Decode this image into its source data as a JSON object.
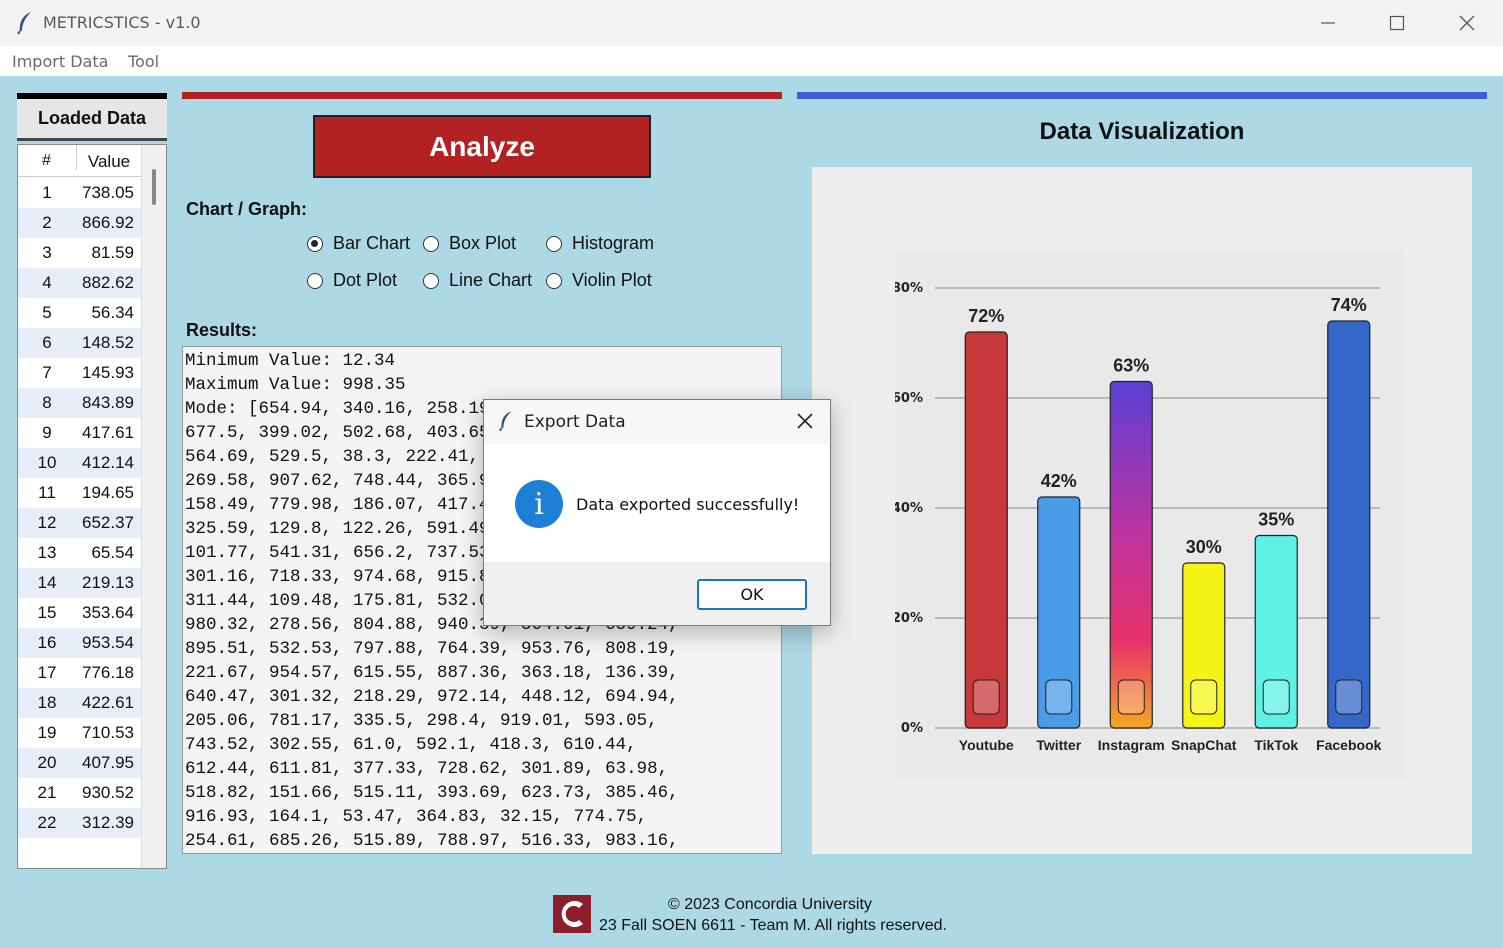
{
  "window": {
    "title": "METRICSTICS - v1.0",
    "icon": "feather-icon"
  },
  "menu": {
    "items": [
      "Import Data",
      "Tool"
    ]
  },
  "loaded_data": {
    "title": "Loaded Data",
    "col_num": "#",
    "col_value": "Value",
    "rows": [
      {
        "n": "1",
        "v": "738.05"
      },
      {
        "n": "2",
        "v": "866.92"
      },
      {
        "n": "3",
        "v": "81.59"
      },
      {
        "n": "4",
        "v": "882.62"
      },
      {
        "n": "5",
        "v": "56.34"
      },
      {
        "n": "6",
        "v": "148.52"
      },
      {
        "n": "7",
        "v": "145.93"
      },
      {
        "n": "8",
        "v": "843.89"
      },
      {
        "n": "9",
        "v": "417.61"
      },
      {
        "n": "10",
        "v": "412.14"
      },
      {
        "n": "11",
        "v": "194.65"
      },
      {
        "n": "12",
        "v": "652.37"
      },
      {
        "n": "13",
        "v": "65.54"
      },
      {
        "n": "14",
        "v": "219.13"
      },
      {
        "n": "15",
        "v": "353.64"
      },
      {
        "n": "16",
        "v": "953.54"
      },
      {
        "n": "17",
        "v": "776.18"
      },
      {
        "n": "18",
        "v": "422.61"
      },
      {
        "n": "19",
        "v": "710.53"
      },
      {
        "n": "20",
        "v": "407.95"
      },
      {
        "n": "21",
        "v": "930.52"
      },
      {
        "n": "22",
        "v": "312.39"
      }
    ]
  },
  "controls": {
    "analyze_label": "Analyze",
    "chart_label": "Chart / Graph:",
    "options": [
      "Bar Chart",
      "Box Plot",
      "Histogram",
      "Dot Plot",
      "Line Chart",
      "Violin Plot"
    ],
    "selected": "Bar Chart",
    "results_label": "Results:"
  },
  "results_text": "Minimum Value: 12.34\nMaximum Value: 998.35\nMode: [654.94, 340.16, 258.19, 811.02, 189.22,\n677.5, 399.02, 502.68, 403.65, 897.96, 725.13,\n564.69, 529.5, 38.3, 222.41, 708.66, 475.59,\n269.58, 907.62, 748.44, 365.94, 672.06, 18.02,\n158.49, 779.98, 186.07, 417.41, 574.15, 93.18,\n325.59, 129.8, 122.26, 591.49, 859.34, 46.23,\n101.77, 541.31, 656.2, 737.53, 285.83, 619.12,\n301.16, 718.33, 974.68, 915.82, 267.34, 480.5,\n311.44, 109.48, 175.81, 532.09, 441.77, 822.6,\n980.32, 278.56, 804.88, 940.39, 564.01, 659.24,\n895.51, 532.53, 797.88, 764.39, 953.76, 808.19,\n221.67, 954.57, 615.55, 887.36, 363.18, 136.39,\n640.47, 301.32, 218.29, 972.14, 448.12, 694.94,\n205.06, 781.17, 335.5, 298.4, 919.01, 593.05,\n743.52, 302.55, 61.0, 592.1, 418.3, 610.44,\n612.44, 611.81, 377.33, 728.62, 301.89, 63.98,\n518.82, 151.66, 515.11, 393.69, 623.73, 385.46,\n916.93, 164.1, 53.47, 364.83, 32.15, 774.75,\n254.61, 685.26, 515.89, 788.97, 516.33, 983.16,",
  "visualization": {
    "title": "Data Visualization"
  },
  "chart_data": {
    "type": "bar",
    "categories": [
      "Youtube",
      "Twitter",
      "Instagram",
      "SnapChat",
      "TikTok",
      "Facebook"
    ],
    "values": [
      72,
      42,
      63,
      30,
      35,
      74
    ],
    "value_labels": [
      "72%",
      "42%",
      "63%",
      "30%",
      "35%",
      "74%"
    ],
    "y_ticks": [
      "0%",
      "20%",
      "40%",
      "60%",
      "80%"
    ],
    "ylim": [
      0,
      80
    ],
    "grid": true,
    "colors": [
      "#c8373a",
      "#4a9be8",
      "#8a3fd1",
      "#f6f316",
      "#5ff0e6",
      "#3467c8"
    ],
    "icons": [
      "youtube-icon",
      "twitter-icon",
      "instagram-icon",
      "snapchat-icon",
      "tiktok-icon",
      "facebook-icon"
    ]
  },
  "footer": {
    "line1": "© 2023 Concordia University",
    "line2": "23 Fall SOEN 6611 - Team M. All rights reserved.",
    "logo": "concordia-logo"
  },
  "dialog": {
    "title": "Export Data",
    "message": "Data exported successfully!",
    "ok_label": "OK",
    "icon": "info-icon"
  },
  "colors": {
    "background": "#add8e6",
    "accent_red": "#b22222",
    "accent_blue": "#3e5fd8"
  }
}
